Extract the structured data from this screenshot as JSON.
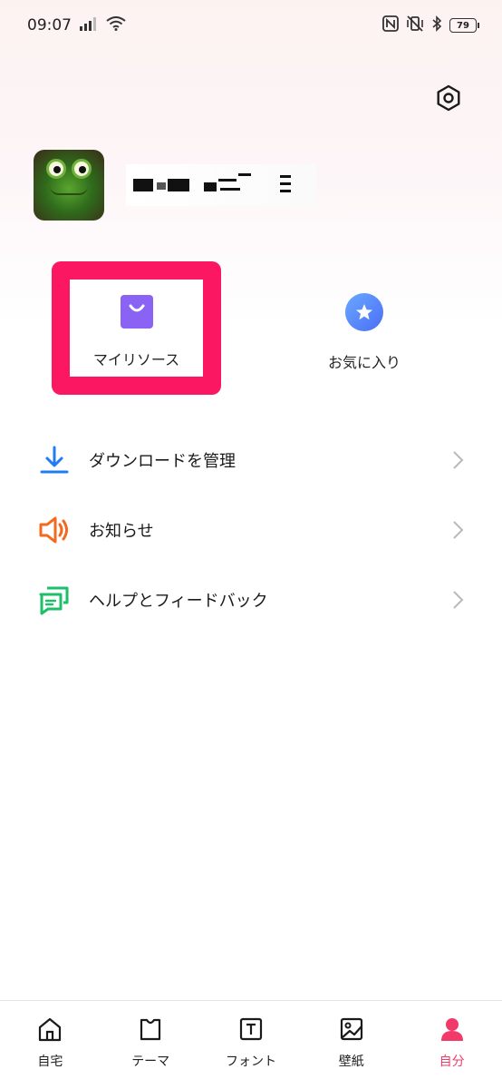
{
  "status_bar": {
    "time": "09:07",
    "battery": "79"
  },
  "profile": {
    "avatar_icon": "frog-avatar"
  },
  "quick_actions": [
    {
      "label": "マイリソース",
      "icon": "shopping-bag-icon",
      "color": "#8a63f5"
    },
    {
      "label": "お気に入り",
      "icon": "star-icon",
      "color": "#4a7cf6"
    }
  ],
  "highlight_color": "#fc1763",
  "menu": [
    {
      "label": "ダウンロードを管理",
      "icon": "download-icon",
      "color": "#1f7cf5"
    },
    {
      "label": "お知らせ",
      "icon": "speaker-icon",
      "color": "#f26a1f"
    },
    {
      "label": "ヘルプとフィードバック",
      "icon": "chat-bubbles-icon",
      "color": "#1fbf6a"
    }
  ],
  "bottom_nav": [
    {
      "label": "自宅",
      "icon": "home-icon"
    },
    {
      "label": "テーマ",
      "icon": "theme-shirt-icon"
    },
    {
      "label": "フォント",
      "icon": "font-icon"
    },
    {
      "label": "壁紙",
      "icon": "wallpaper-icon"
    },
    {
      "label": "自分",
      "icon": "person-icon",
      "active": true,
      "active_color": "#f13a6a"
    }
  ]
}
